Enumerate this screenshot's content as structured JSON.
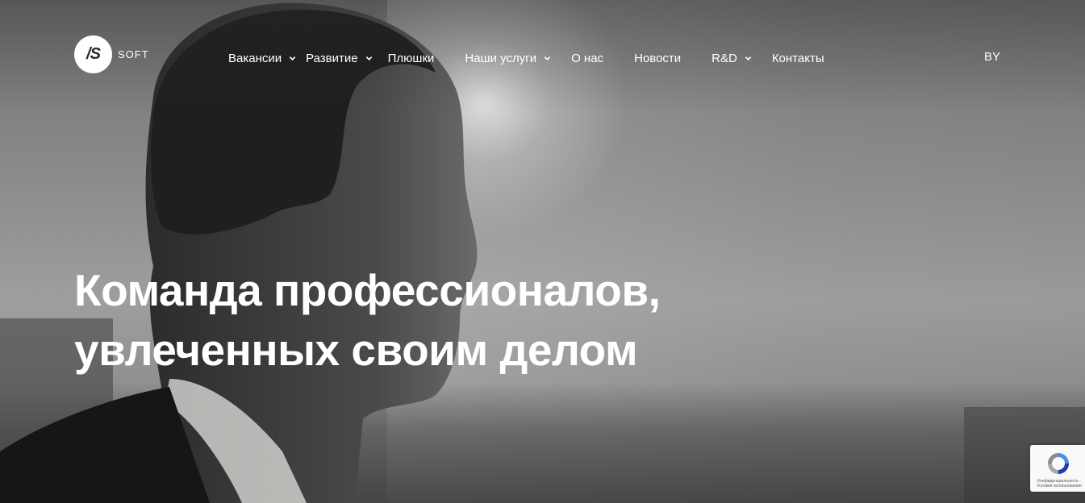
{
  "brand": {
    "logo_mark": "/S",
    "logo_text": "SOFT"
  },
  "nav": {
    "items": [
      {
        "label": "Вакансии",
        "has_dropdown": true
      },
      {
        "label": "Развитие",
        "has_dropdown": true
      },
      {
        "label": "Плюшки",
        "has_dropdown": false
      },
      {
        "label": "Наши услуги",
        "has_dropdown": true
      },
      {
        "label": "О нас",
        "has_dropdown": false
      },
      {
        "label": "Новости",
        "has_dropdown": false
      },
      {
        "label": "R&D",
        "has_dropdown": true
      },
      {
        "label": "Контакты",
        "has_dropdown": false
      }
    ],
    "dropdown_icon": "chevron-down-icon"
  },
  "language": {
    "label": "BY"
  },
  "hero": {
    "headline_line1": "Команда профессионалов,",
    "headline_line2": "увлеченных своим делом"
  },
  "recaptcha": {
    "text": "Конфиденциальность - Условия использования",
    "icon": "recaptcha-icon"
  },
  "colors": {
    "text": "#ffffff",
    "logo_bg": "#ffffff",
    "logo_fg": "#2a2a2a"
  }
}
